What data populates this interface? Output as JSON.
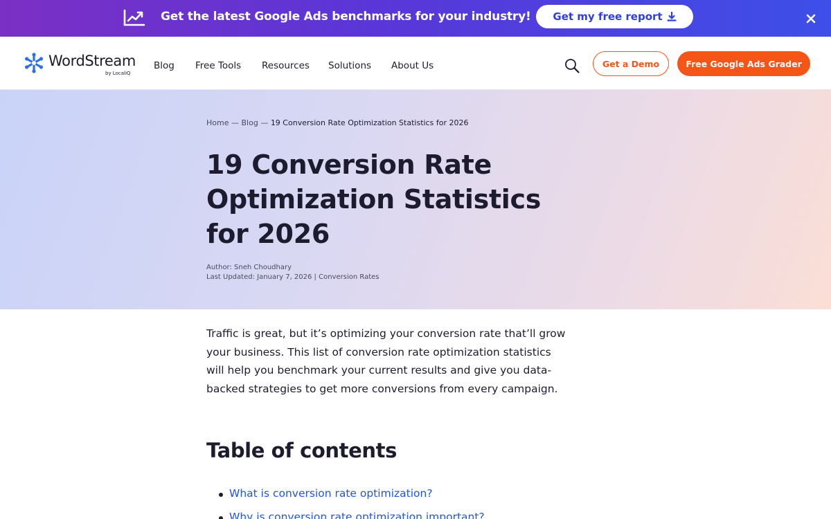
{
  "promo": {
    "text": "Get the latest Google Ads benchmarks for your industry!",
    "cta_label": "Get my free report",
    "icon": "trend-chart-icon",
    "close_icon": "close-icon",
    "background_from": "#7b2fc4",
    "background_to": "#3d4fe8"
  },
  "header": {
    "logo_text": "WordStream",
    "logo_subtext": "by LocaliQ",
    "nav": [
      "Blog",
      "Free Tools",
      "Resources",
      "Solutions",
      "About Us"
    ],
    "search_icon": "search-icon",
    "demo_label": "Get a Demo",
    "grader_label": "Free Google Ads Grader",
    "accent_color": "#f55516"
  },
  "hero": {
    "breadcrumb": {
      "home": "Home",
      "separator": "—",
      "blog": "Blog",
      "current": "19 Conversion Rate Optimization Statistics for 2026"
    },
    "title": "19 Conversion Rate Optimization Statistics for 2026",
    "author_line": "Author: Sneh Choudhary",
    "updated_prefix": "Last Updated: January 7, 2026 | ",
    "category": "Conversion Rates"
  },
  "article": {
    "intro": "Traffic is great, but it’s optimizing your conversion rate that’ll grow your business. This list of conversion rate optimization statistics will help you benchmark your current results and give you data-backed strategies to get more conversions from every campaign.",
    "toc_heading": "Table of contents",
    "toc_items": [
      "What is conversion rate optimization?",
      "Why is conversion rate optimization important?"
    ],
    "link_color": "#2256e0"
  }
}
